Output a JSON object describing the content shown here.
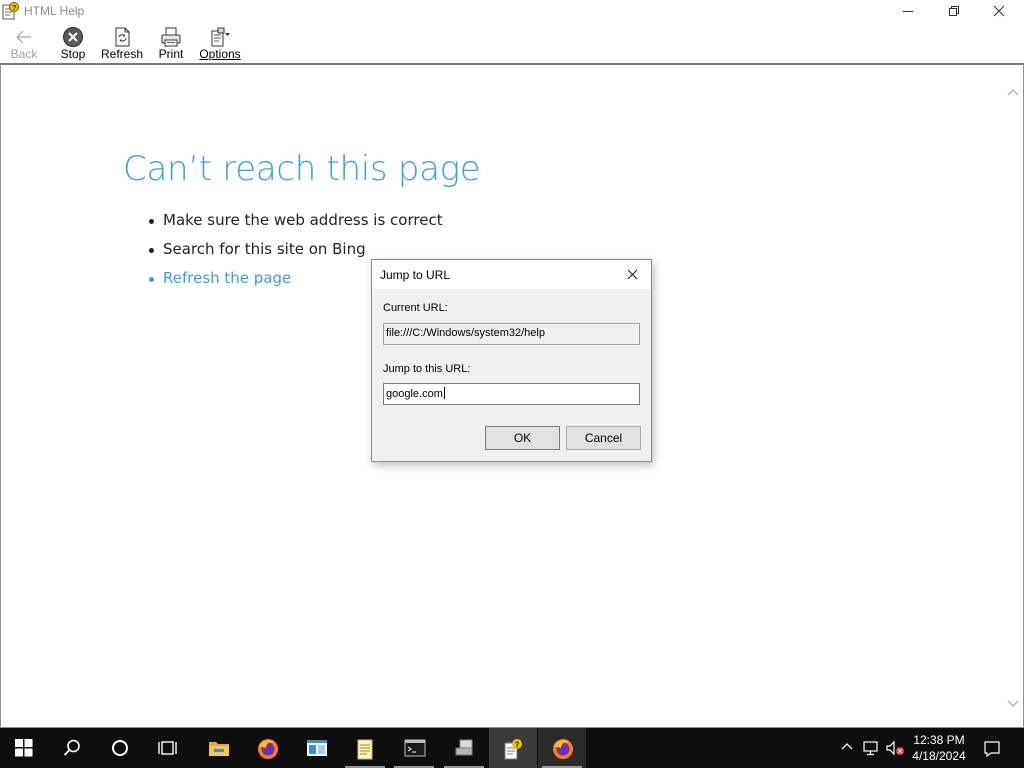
{
  "window": {
    "title": "HTML Help"
  },
  "toolbar": {
    "back_label": "Back",
    "stop_label": "Stop",
    "refresh_label": "Refresh",
    "print_label": "Print",
    "options_label": "Options"
  },
  "page": {
    "heading": "Can’t reach this page",
    "bullets": [
      "Make sure the web address is correct",
      "Search for this site on Bing",
      "Refresh the page"
    ]
  },
  "dialog": {
    "title": "Jump to URL",
    "current_url_label": "Current URL:",
    "current_url_value": "file:///C:/Windows/system32/help",
    "jump_label": "Jump to this URL:",
    "jump_value": "google.com",
    "ok_label": "OK",
    "cancel_label": "Cancel"
  },
  "taskbar": {
    "items": [
      "start-icon",
      "search-icon",
      "cortana-icon",
      "task-view-icon",
      "file-explorer-icon",
      "firefox-icon",
      "app-window-icon",
      "notepad-icon",
      "terminal-icon",
      "network-drive-icon",
      "html-help-icon",
      "firefox-icon"
    ],
    "tray": [
      "chevron-up-icon",
      "network-icon",
      "volume-muted-icon",
      "notification-icon"
    ],
    "time": "12:38 PM",
    "date": "4/18/2024"
  },
  "colors": {
    "heading": "#3aa0d8",
    "link": "#3aa0d8",
    "taskbar": "#0e0e0e"
  }
}
